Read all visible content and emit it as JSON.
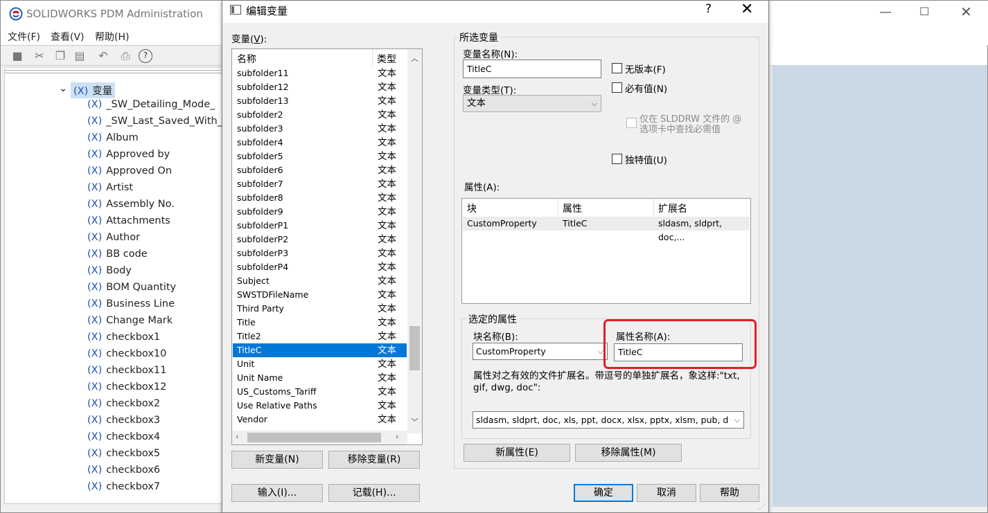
{
  "app": {
    "title": "SOLIDWORKS PDM Administration",
    "menus": [
      "文件(F)",
      "查看(V)",
      "帮助(H)"
    ],
    "window_controls": {
      "minimize": "—",
      "maximize": "☐",
      "close": "✕"
    }
  },
  "tree": {
    "root": "变量",
    "root_prefix": "(X)",
    "items": [
      "_SW_Detailing_Mode_",
      "_SW_Last_Saved_With_",
      "Album",
      "Approved by",
      "Approved On",
      "Artist",
      "Assembly No.",
      "Attachments",
      "Author",
      "BB code",
      "Body",
      "BOM Quantity",
      "Business Line",
      "Change Mark",
      "checkbox1",
      "checkbox10",
      "checkbox11",
      "checkbox12",
      "checkbox2",
      "checkbox3",
      "checkbox4",
      "checkbox5",
      "checkbox6",
      "checkbox7"
    ],
    "prefix": "(X)"
  },
  "dialog": {
    "title": "编辑变量",
    "help_glyph": "?",
    "close_glyph": "✕",
    "variables_label": "变量(",
    "variables_key": "V",
    "variables_suffix": "):",
    "list_headers": {
      "name": "名称",
      "type": "类型"
    },
    "variables": [
      {
        "name": "subfolder11",
        "type": "文本"
      },
      {
        "name": "subfolder12",
        "type": "文本"
      },
      {
        "name": "subfolder13",
        "type": "文本"
      },
      {
        "name": "subfolder2",
        "type": "文本"
      },
      {
        "name": "subfolder3",
        "type": "文本"
      },
      {
        "name": "subfolder4",
        "type": "文本"
      },
      {
        "name": "subfolder5",
        "type": "文本"
      },
      {
        "name": "subfolder6",
        "type": "文本"
      },
      {
        "name": "subfolder7",
        "type": "文本"
      },
      {
        "name": "subfolder8",
        "type": "文本"
      },
      {
        "name": "subfolder9",
        "type": "文本"
      },
      {
        "name": "subfolderP1",
        "type": "文本"
      },
      {
        "name": "subfolderP2",
        "type": "文本"
      },
      {
        "name": "subfolderP3",
        "type": "文本"
      },
      {
        "name": "subfolderP4",
        "type": "文本"
      },
      {
        "name": "Subject",
        "type": "文本"
      },
      {
        "name": "SWSTDFileName",
        "type": "文本"
      },
      {
        "name": "Third Party",
        "type": "文本"
      },
      {
        "name": "Title",
        "type": "文本"
      },
      {
        "name": "Title2",
        "type": "文本"
      },
      {
        "name": "TitleC",
        "type": "文本",
        "selected": true
      },
      {
        "name": "Unit",
        "type": "文本"
      },
      {
        "name": "Unit Name",
        "type": "文本"
      },
      {
        "name": "US_Customs_Tariff",
        "type": "文本"
      },
      {
        "name": "Use Relative Paths",
        "type": "文本"
      },
      {
        "name": "Vendor",
        "type": "文本"
      }
    ],
    "buttons": {
      "new_variable": "新变量(N)",
      "remove_variable": "移除变量(R)",
      "import": "输入(I)...",
      "export": "记载(H)...",
      "ok": "确定",
      "cancel": "取消",
      "help": "帮助",
      "new_property": "新属性(E)",
      "remove_property": "移除属性(M)"
    },
    "selected_variable": {
      "group_label": "所选变量",
      "name_label": "变量名称(N):",
      "name_value": "TitleC",
      "type_label": "变量类型(T):",
      "type_value": "文本",
      "no_version_label": "无版本(F)",
      "mandatory_label": "必有值(N)",
      "slddrw_label_line1": "仅在 SLDDRW 文件的 @",
      "slddrw_label_line2": "选项卡中查找必需值",
      "unique_label": "独特值(U)",
      "no_version_checked": false,
      "mandatory_checked": false,
      "unique_checked": false
    },
    "attributes": {
      "label": "属性(A):",
      "headers": {
        "block": "块",
        "attribute": "属性",
        "extension": "扩展名"
      },
      "rows": [
        {
          "block": "CustomProperty",
          "attribute": "TitleC",
          "extension": "sldasm, sldprt, doc,..."
        }
      ]
    },
    "selected_attribute": {
      "group_label": "选定的属性",
      "block_label": "块名称(B):",
      "block_value": "CustomProperty",
      "attr_label": "属性名称(A):",
      "attr_value": "TitleC",
      "ext_help": "属性对之有效的文件扩展名。带逗号的单独扩展名，象这样:\"txt, gif, dwg, doc\":",
      "ext_value": "sldasm, sldprt, doc, xls, ppt, docx, xlsx, pptx, xlsm, pub, dot, mp"
    }
  },
  "colors": {
    "accent": "#0078d7",
    "highlight_box": "#e02020",
    "tree_prefix": "#1a4fb5"
  }
}
